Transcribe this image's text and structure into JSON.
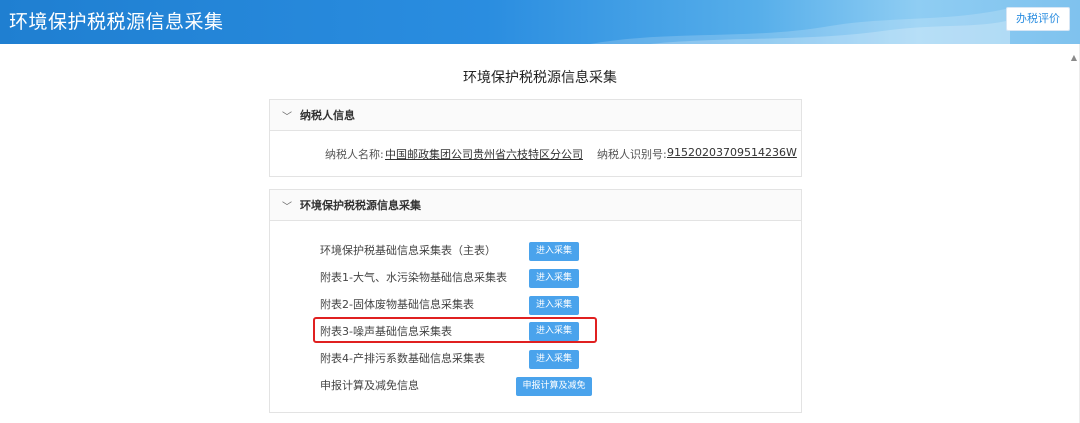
{
  "header": {
    "app_title": "环境保护税税源信息采集",
    "rate_button": "办税评价"
  },
  "page_title": "环境保护税税源信息采集",
  "taxpayer_panel": {
    "title": "纳税人信息",
    "name_label": "纳税人名称:",
    "name_value": "中国邮政集团公司贵州省六枝特区分公司",
    "id_label": "纳税人识别号:",
    "id_value": "91520203709514236W"
  },
  "collection_panel": {
    "title": "环境保护税税源信息采集",
    "rows": [
      {
        "label": "环境保护税基础信息采集表（主表）",
        "button": "进入采集"
      },
      {
        "label": "附表1-大气、水污染物基础信息采集表",
        "button": "进入采集"
      },
      {
        "label": "附表2-固体废物基础信息采集表",
        "button": "进入采集"
      },
      {
        "label": "附表3-噪声基础信息采集表",
        "button": "进入采集"
      },
      {
        "label": "附表4-产排污系数基础信息采集表",
        "button": "进入采集"
      },
      {
        "label": "申报计算及减免信息",
        "button": "申报计算及减免"
      }
    ]
  },
  "colors": {
    "header_blue": "#1f7fd1",
    "button_blue": "#4aa3ec",
    "highlight_red": "#e02020"
  },
  "icons": {
    "panel_toggle": "chevron-down-icon",
    "scroll_up": "scroll-up-arrow-icon"
  }
}
